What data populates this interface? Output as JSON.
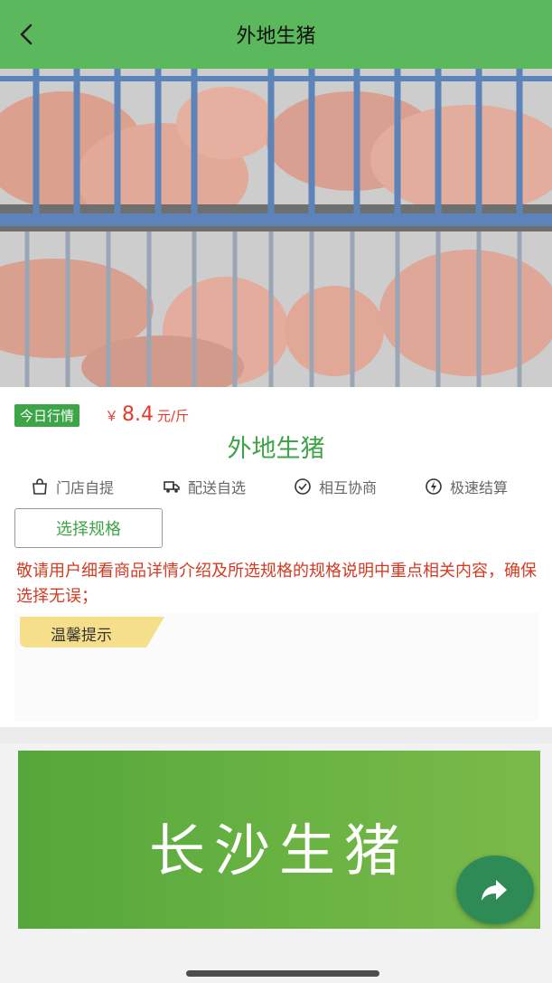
{
  "header": {
    "title": "外地生猪",
    "back_icon": "chevron-left-icon"
  },
  "hero": {
    "image_desc_icon": "product-photo",
    "carousel_active_index": 1,
    "carousel_total": 1
  },
  "product": {
    "badge": "今日行情",
    "price_symbol": "￥",
    "price_value": "8.4",
    "price_unit": "元/斤",
    "name": "外地生猪"
  },
  "features": [
    {
      "icon": "shopping-bag-icon",
      "label": "门店自提"
    },
    {
      "icon": "delivery-truck-icon",
      "label": "配送自选"
    },
    {
      "icon": "check-circle-icon",
      "label": "相互协商"
    },
    {
      "icon": "lightning-icon",
      "label": "极速结算"
    }
  ],
  "spec_button": "选择规格",
  "notice": "敬请用户细看商品详情介绍及所选规格的规格说明中重点相关内容，确保选择无误；",
  "tips": {
    "label": "温馨提示"
  },
  "banner": {
    "title": "长沙生猪"
  },
  "share": {
    "icon": "share-arrow-icon"
  },
  "colors": {
    "header": "#5cb85c",
    "accent_green": "#3da547",
    "price_red": "#e53a2a",
    "notice_red": "#d23b22",
    "banner_green": "#6ab343",
    "share_button": "#2f8b56"
  }
}
